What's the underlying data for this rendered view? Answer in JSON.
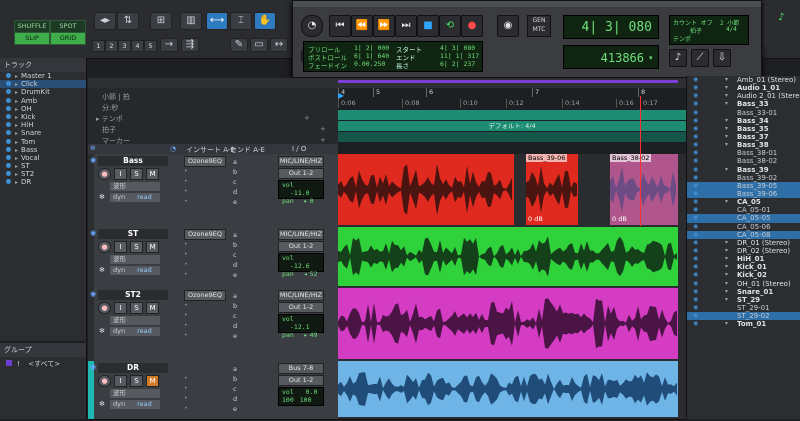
{
  "toolbar": {
    "mode_buttons": [
      "SHUFFLE",
      "SPOT",
      "SLIP",
      "GRID"
    ],
    "mode_states": [
      "off",
      "off",
      "on",
      "on"
    ],
    "number_buttons": [
      "1",
      "2",
      "3",
      "4",
      "5"
    ]
  },
  "transport": {
    "pre_roll_label": "プリロール",
    "post_roll_label": "ポストロール",
    "fade_in_label": "フェードイン",
    "pre_roll": "1| 2| 000",
    "post_roll": "6| 1| 640",
    "fade_in": "0.00.250",
    "start_label": "スタート",
    "end_label": "エンド",
    "length_label": "長さ",
    "start": "4| 3| 080",
    "end": "11| 1| 317",
    "length": "6| 2| 237",
    "gen_label": "GEN",
    "mtc_label": "MTC",
    "main_counter": "4| 3| 080",
    "sub_counter": "413866",
    "sub_arrow": "▾",
    "count_off_label": "カウント オフ",
    "meter_label": "拍子",
    "meter_value": "4/4",
    "tempo_label": "テンポ",
    "bars_label": "2 小節"
  },
  "track_list": {
    "title": "トラック",
    "items": [
      {
        "name": "Master 1",
        "selected": false
      },
      {
        "name": "Click",
        "selected": true
      },
      {
        "name": "DrumKit",
        "selected": false
      },
      {
        "name": "Amb",
        "selected": false
      },
      {
        "name": "OH",
        "selected": false
      },
      {
        "name": "Kick",
        "selected": false
      },
      {
        "name": "HiH",
        "selected": false
      },
      {
        "name": "Snare",
        "selected": false
      },
      {
        "name": "Tom",
        "selected": false
      },
      {
        "name": "Bass",
        "selected": false
      },
      {
        "name": "Vocal",
        "selected": false
      },
      {
        "name": "ST",
        "selected": false
      },
      {
        "name": "ST2",
        "selected": false
      },
      {
        "name": "DR",
        "selected": false
      }
    ]
  },
  "groups": {
    "title": "グループ",
    "items": [
      {
        "id": "!",
        "name": "<すべて>"
      }
    ]
  },
  "rulers": {
    "bars_label": "小節 | 拍",
    "minsec_label": "分:秒",
    "tempo_label": "テンポ",
    "meter_label": "拍子",
    "markers_label": "マーカー",
    "bar_numbers": [
      "4",
      "5",
      "6",
      "7",
      "8"
    ],
    "time_ticks": [
      "0:06",
      "0:08",
      "0:10",
      "0:12",
      "0:14",
      "0:16",
      "0:17"
    ],
    "meter_default": "デフォルト: 4/4"
  },
  "columns": {
    "inserts": "インサート A-E",
    "sends": "センド A-E",
    "io": "I / O"
  },
  "tracks": [
    {
      "name": "Bass",
      "insert": "Ozone9EQ",
      "sends": [
        "a",
        "b",
        "c",
        "d",
        "e"
      ],
      "input": "MIC/LINE/HIZ",
      "output": "Out 1-2",
      "vol": "-11.0",
      "pan": "0",
      "pan_dir": "▸",
      "view": "波形",
      "auto": "dyn",
      "mode": "read",
      "color": "#e02a1f",
      "wave": "#4a1410",
      "clips": [
        {
          "name": "Bass_39-06",
          "gain": "0 dB"
        },
        {
          "name": "Bass_38-02",
          "gain": "0 dB"
        }
      ]
    },
    {
      "name": "ST",
      "insert": "Ozone9EQ",
      "sends": [
        "a",
        "b",
        "c",
        "d",
        "e"
      ],
      "input": "MIC/LINE/HIZ",
      "output": "Out 1-2",
      "vol": "-12.6",
      "pan": "52",
      "pan_dir": "◂",
      "view": "波形",
      "auto": "dyn",
      "mode": "read",
      "color": "#2fd23a",
      "wave": "#14401a",
      "clips": []
    },
    {
      "name": "ST2",
      "insert": "Ozone9EQ",
      "sends": [
        "a",
        "b",
        "c",
        "d",
        "e"
      ],
      "input": "MIC/LINE/HIZ",
      "output": "Out 1-2",
      "vol": "-12.1",
      "pan": "49",
      "pan_dir": "▸",
      "view": "波形",
      "auto": "dyn",
      "mode": "read",
      "color": "#d43cc4",
      "wave": "#4a1444",
      "clips": []
    },
    {
      "name": "DR",
      "insert": "",
      "sends": [
        "a",
        "b",
        "c",
        "d",
        "e"
      ],
      "input": "Bus 7-8",
      "output": "Out 1-2",
      "vol": "0.0",
      "pan_l": "100",
      "pan_r": "100",
      "view": "波形",
      "auto": "dyn",
      "mode": "read",
      "color": "#6fb4e6",
      "wave": "#1f4c78",
      "clips": []
    }
  ],
  "track_buttons": {
    "rec": "●",
    "input": "I",
    "solo": "S",
    "mute": "M"
  },
  "clip_list": [
    {
      "name": "Amb_01 (Stereo)",
      "kind": "stereo",
      "sel": false
    },
    {
      "name": "Audio 1_01",
      "kind": "bold",
      "sel": false
    },
    {
      "name": "Audio 2_01 (Stereo)",
      "kind": "stereo",
      "sel": false
    },
    {
      "name": "Bass_33",
      "kind": "bold",
      "sel": false
    },
    {
      "name": "Bass_33-01",
      "kind": "sub",
      "sel": false
    },
    {
      "name": "Bass_34",
      "kind": "bold",
      "sel": false
    },
    {
      "name": "Bass_35",
      "kind": "bold",
      "sel": false
    },
    {
      "name": "Bass_37",
      "kind": "bold",
      "sel": false
    },
    {
      "name": "Bass_38",
      "kind": "bold",
      "sel": false
    },
    {
      "name": "Bass_38-01",
      "kind": "sub",
      "sel": false
    },
    {
      "name": "Bass_38-02",
      "kind": "sub",
      "sel": false
    },
    {
      "name": "Bass_39",
      "kind": "bold",
      "sel": false
    },
    {
      "name": "Bass_39-02",
      "kind": "sub",
      "sel": false
    },
    {
      "name": "Bass_39-05",
      "kind": "sub",
      "sel": true
    },
    {
      "name": "Bass_39-06",
      "kind": "sub",
      "sel": true
    },
    {
      "name": "CA_05",
      "kind": "bold",
      "sel": false
    },
    {
      "name": "CA_05-01",
      "kind": "sub",
      "sel": false
    },
    {
      "name": "CA_05-05",
      "kind": "sub",
      "sel": true
    },
    {
      "name": "CA_05-06",
      "kind": "sub",
      "sel": false
    },
    {
      "name": "CA_05-08",
      "kind": "sub",
      "sel": true
    },
    {
      "name": "DR_01 (Stereo)",
      "kind": "stereo",
      "sel": false
    },
    {
      "name": "DR_02 (Stereo)",
      "kind": "stereo",
      "sel": false
    },
    {
      "name": "HiH_01",
      "kind": "bold",
      "sel": false
    },
    {
      "name": "Kick_01",
      "kind": "bold",
      "sel": false
    },
    {
      "name": "Kick_02",
      "kind": "bold",
      "sel": false
    },
    {
      "name": "OH_01 (Stereo)",
      "kind": "stereo",
      "sel": false
    },
    {
      "name": "Snare_01",
      "kind": "bold",
      "sel": false
    },
    {
      "name": "ST_29",
      "kind": "bold",
      "sel": false
    },
    {
      "name": "ST_29-01",
      "kind": "sub",
      "sel": false
    },
    {
      "name": "ST_29-02",
      "kind": "sub",
      "sel": true
    },
    {
      "name": "Tom_01",
      "kind": "bold",
      "sel": false
    }
  ],
  "colors": {
    "playhead": "#ff3030",
    "selection": "#2e7bc0",
    "meter_bar": "#1e8c73"
  }
}
